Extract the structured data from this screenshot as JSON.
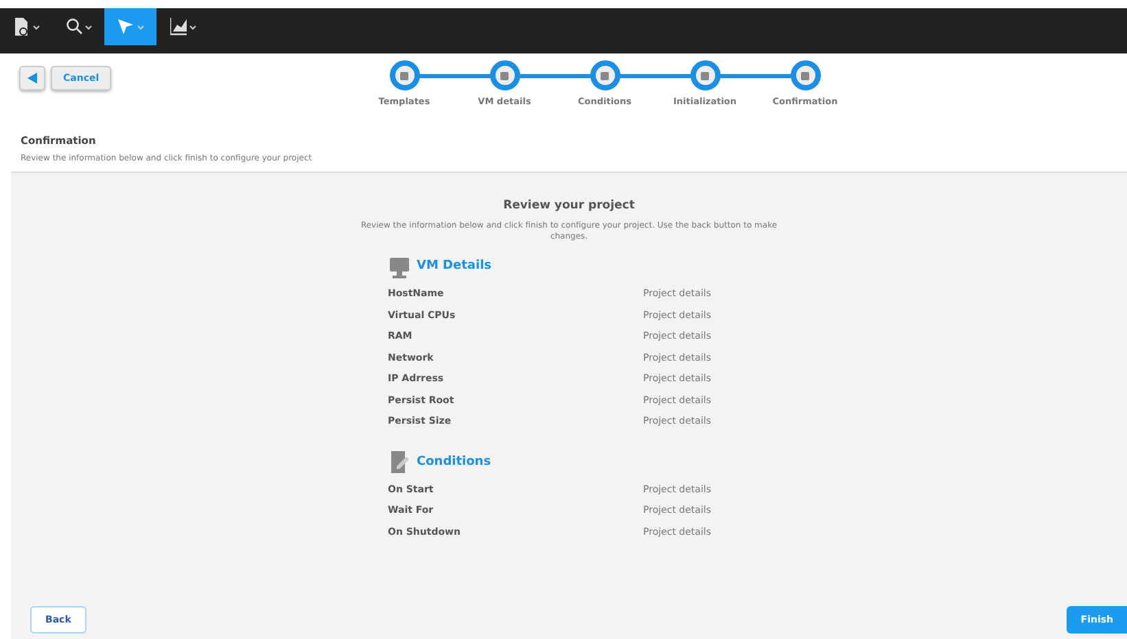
{
  "toolbar": [
    {
      "selected": false
    },
    {
      "selected": false
    },
    {
      "selected": true
    },
    {
      "selected": false
    }
  ],
  "header": {
    "cancel": "Cancel",
    "title": "Confirmation",
    "subtitle": "Review the information below and click finish to configure your project"
  },
  "steps": [
    {
      "label": "Templates"
    },
    {
      "label": "VM details"
    },
    {
      "label": "Conditions"
    },
    {
      "label": "Initialization"
    },
    {
      "label": "Confirmation"
    }
  ],
  "review": {
    "title": "Review your project",
    "description": "Review the information below and click finish to configure your project. Use the back button to make changes.",
    "sections": [
      {
        "title": "VM Details",
        "rows": [
          {
            "label": "HostName",
            "value": "Project details"
          },
          {
            "label": "Virtual CPUs",
            "value": "Project details"
          },
          {
            "label": "RAM",
            "value": "Project details"
          },
          {
            "label": "Network",
            "value": "Project details"
          },
          {
            "label": "IP Adrress",
            "value": "Project details"
          },
          {
            "label": "Persist Root",
            "value": "Project details"
          },
          {
            "label": "Persist Size",
            "value": "Project details"
          }
        ]
      },
      {
        "title": "Conditions",
        "rows": [
          {
            "label": "On Start",
            "value": "Project details"
          },
          {
            "label": "Wait For",
            "value": "Project details"
          },
          {
            "label": "On Shutdown",
            "value": "Project details"
          }
        ]
      }
    ]
  },
  "footer": {
    "back": "Back",
    "finish": "Finish"
  }
}
